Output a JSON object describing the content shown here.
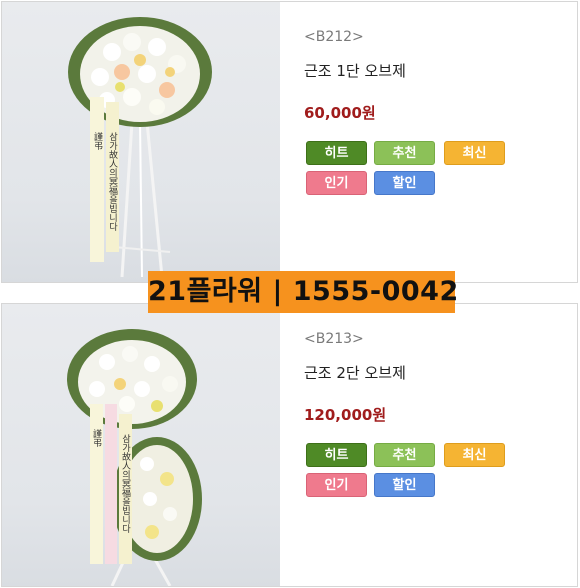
{
  "products": [
    {
      "code": "<B212>",
      "name": "근조 1단 오브제",
      "price": "60,000원",
      "ribbon_text": "삼가 故人의 冥福을 빕니다",
      "badges": {
        "hit": "히트",
        "recommend": "추천",
        "new": "최신",
        "popular": "인기",
        "sale": "할인"
      }
    },
    {
      "code": "<B213>",
      "name": "근조 2단 오브제",
      "price": "120,000원",
      "ribbon_text": "삼가 故人의 冥福을 빕니다",
      "badges": {
        "hit": "히트",
        "recommend": "추천",
        "new": "최신",
        "popular": "인기",
        "sale": "할인"
      }
    }
  ],
  "banner": {
    "text": "21플라워 | 1555-0042"
  },
  "colors": {
    "price": "#a01c1c",
    "badge_hit": "#4f8a26",
    "badge_recommend": "#8cc158",
    "badge_new": "#f5b433",
    "badge_popular": "#ef7a8d",
    "badge_sale": "#5b8fe2",
    "banner_bg": "#f6921e"
  }
}
